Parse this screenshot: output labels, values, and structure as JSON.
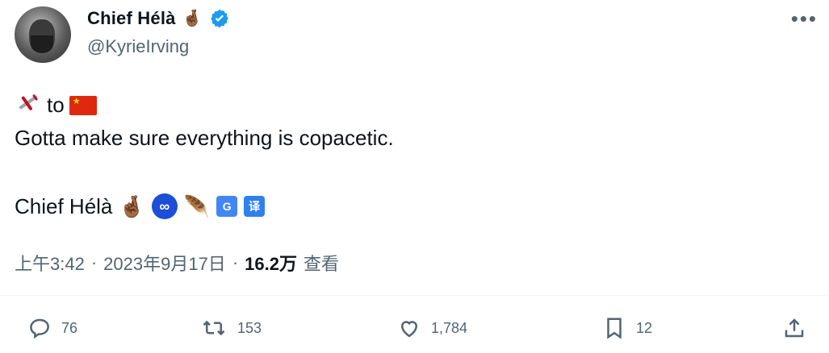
{
  "author": {
    "display_name": "Chief Hélà",
    "display_name_emoji": "🤞🏾",
    "handle": "@KyrieIrving",
    "verified": true
  },
  "header": {
    "more_icon": "more-icon"
  },
  "tweet": {
    "line1_word": "to",
    "line2": "Gotta make sure everything is copacetic.",
    "signature_name": "Chief Hélà",
    "signature_emojis": [
      "🤞🏾",
      "∞",
      "🪶"
    ],
    "translate_badges": [
      "G",
      "译"
    ]
  },
  "meta": {
    "time": "上午3:42",
    "separator": "·",
    "date": "2023年9月17日",
    "views_count": "16.2万",
    "views_label": "查看"
  },
  "actions": {
    "reply": "76",
    "retweet": "153",
    "like": "1,784",
    "bookmark": "12"
  },
  "colors": {
    "text": "#0f1419",
    "muted": "#536471",
    "verified": "#1d9bf0",
    "flag_red": "#de2910",
    "flag_yellow": "#ffde00"
  }
}
